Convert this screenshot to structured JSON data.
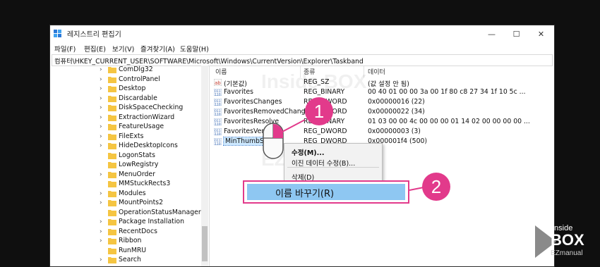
{
  "window": {
    "title": "레지스트리 편집기",
    "min": "—",
    "max": "☐",
    "close": "✕"
  },
  "menu": [
    "파일(F)",
    "편집(E)",
    "보기(V)",
    "즐겨찾기(A)",
    "도움말(H)"
  ],
  "address": "컴퓨터\\HKEY_CURRENT_USER\\SOFTWARE\\Microsoft\\Windows\\CurrentVersion\\Explorer\\Taskband",
  "tree": [
    "ComDlg32",
    "ControlPanel",
    "Desktop",
    "Discardable",
    "DiskSpaceChecking",
    "ExtractionWizard",
    "FeatureUsage",
    "FileExts",
    "HideDesktopIcons",
    "LogonStats",
    "LowRegistry",
    "MenuOrder",
    "MMStuckRects3",
    "Modules",
    "MountPoints2",
    "OperationStatusManager",
    "Package Installation",
    "RecentDocs",
    "Ribbon",
    "RunMRU",
    "Search"
  ],
  "columns": {
    "name": "이름",
    "type": "종류",
    "data": "데이터"
  },
  "values": [
    {
      "name": "(기본값)",
      "type": "REG_SZ",
      "data": "(값 설정 안 됨)",
      "icon": "ab"
    },
    {
      "name": "Favorites",
      "type": "REG_BINARY",
      "data": "00 40 01 00 00 3a 00 1f 80 c8 27 34 1f 10 5c ...",
      "icon": "bin"
    },
    {
      "name": "FavoritesChanges",
      "type": "REG_DWORD",
      "data": "0x00000016 (22)",
      "icon": "bin"
    },
    {
      "name": "FavoritesRemovedChanges",
      "type": "REG_DWORD",
      "data": "0x00000022 (34)",
      "icon": "bin"
    },
    {
      "name": "FavoritesResolve",
      "type": "REG_BINARY",
      "data": "01 03 00 00 4c 00 00 00 01 14 02 00 00 00 00 ...",
      "icon": "bin"
    },
    {
      "name": "FavoritesVersion",
      "type": "REG_DWORD",
      "data": "0x00000003 (3)",
      "icon": "bin"
    },
    {
      "name": "MinThumbSizePx",
      "type": "REG_DWORD",
      "data": "0x000001f4 (500)",
      "icon": "bin"
    }
  ],
  "context": {
    "modify": "수정(M)...",
    "modify_bin": "이진 데이터 수정(B)...",
    "delete": "삭제(D)",
    "rename": "이름 바꾸기(R)"
  },
  "badges": {
    "one": "1",
    "two": "2"
  },
  "watermark": {
    "line1": "Inside BOX",
    "line2": "EZmanual"
  },
  "logo": {
    "top": "Inside",
    "mid": "BOX",
    "bot": "EZmanual"
  },
  "colors": {
    "accent": "#e23a8b",
    "highlight": "#8ec7f2",
    "folder": "#f5c542"
  }
}
